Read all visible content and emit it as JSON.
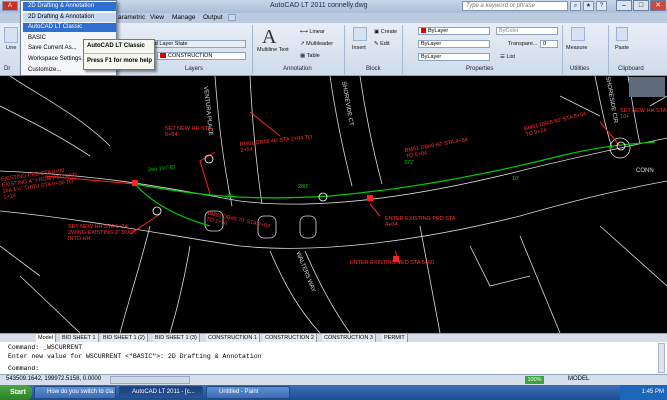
{
  "window": {
    "title": "AutoCAD LT 2011    connelly.dwg",
    "search_placeholder": "Type a keyword or phrase"
  },
  "ribbon_tabs": [
    "arametric",
    "View",
    "Manage",
    "Output"
  ],
  "workspace_menu": {
    "items": [
      "2D Drafting & Annotation",
      "2D Drafting & Annotation",
      "AutoCAD LT Classic",
      "BASIC",
      "Save Current As...",
      "Workspace Settings...",
      "Customize..."
    ]
  },
  "tooltip": {
    "title": "AutoCAD LT Classic",
    "hint": "Press F1 for more help"
  },
  "ribbon": {
    "draw_label": "Line",
    "modify_frag": "Dr",
    "layers": {
      "state_label": "ved Layer State",
      "current_layer": "CONSTRUCTION",
      "panel_label": "Layers"
    },
    "annotation": {
      "multiline": "Multiline Text",
      "linear": "Linear",
      "multileader": "Multileader",
      "table": "Table",
      "panel_label": "Annotation"
    },
    "block": {
      "insert": "Insert",
      "create": "Create",
      "edit": "Edit",
      "panel_label": "Block"
    },
    "properties": {
      "color": "ByLayer",
      "linetype": "ByLayer",
      "lineweight": "ByLayer",
      "plotstyle": "ByColor",
      "transparency": "Transpare...",
      "transparency_value": "0",
      "list": "List",
      "panel_label": "Properties"
    },
    "utilities": {
      "measure": "Measure",
      "panel_label": "Utilities"
    },
    "clipboard": {
      "paste": "Paste",
      "panel_label": "Clipboard"
    }
  },
  "drawing": {
    "streets": [
      "VENTURA PLACE",
      "SHOREVIDE CT",
      "SHORESIDE CIR",
      "WALTERS WAY",
      "CONN"
    ],
    "labels": [
      "SET NEW HH STA 0+84",
      "EXISTING PED STA 0+00 EXISTING 4\" FROM PED AND 2ea 1¼\" THRU STA 0+00 TO 1+14",
      "SET NEW HH STA 1+14 2WING EXISTING 2\" DUCT INTO HH",
      "BM61 DB#8 48' STA 2+04 TO 2+54",
      "BM61 DB#8 60' STA 4+54 TO 5+04",
      "BM61 DB#8 60' STA 8+54 TO 9+24",
      "SET NEW HH STA 10+",
      "ENTER EXISTING PED STA 4+04",
      "ENTER EXISTING PED STA 5+60",
      "BM61 DB#8 70' STA 2+04 TO 2+50",
      "2ea 1¼\" ID",
      "70'",
      "280'",
      "372'",
      "10'"
    ]
  },
  "layout_tabs": [
    "Model",
    "BID SHEET 1",
    "BID SHEET 1 (2)",
    "BID SHEET 1 (3)",
    "CONSTRUCTION 1",
    "CONSTRUCTION 2",
    "CONSTRUCTION 3",
    "PERMIT"
  ],
  "command": {
    "line1": "Command:  _WSCURRENT",
    "line2": "Enter new value for WSCURRENT <\"BASIC\">: 2D Drafting & Annotation",
    "line3": "Command:"
  },
  "status": {
    "coords": "543509.1642, 199972.5158, 0.0000",
    "zoom": "100%",
    "model": "MODEL"
  },
  "taskbar": {
    "start": "Start",
    "tasks": [
      "How do you switch to cla...",
      "AutoCAD LT 2011 - [c...",
      "Untitled - Paint"
    ],
    "clock": "1:45 PM"
  }
}
